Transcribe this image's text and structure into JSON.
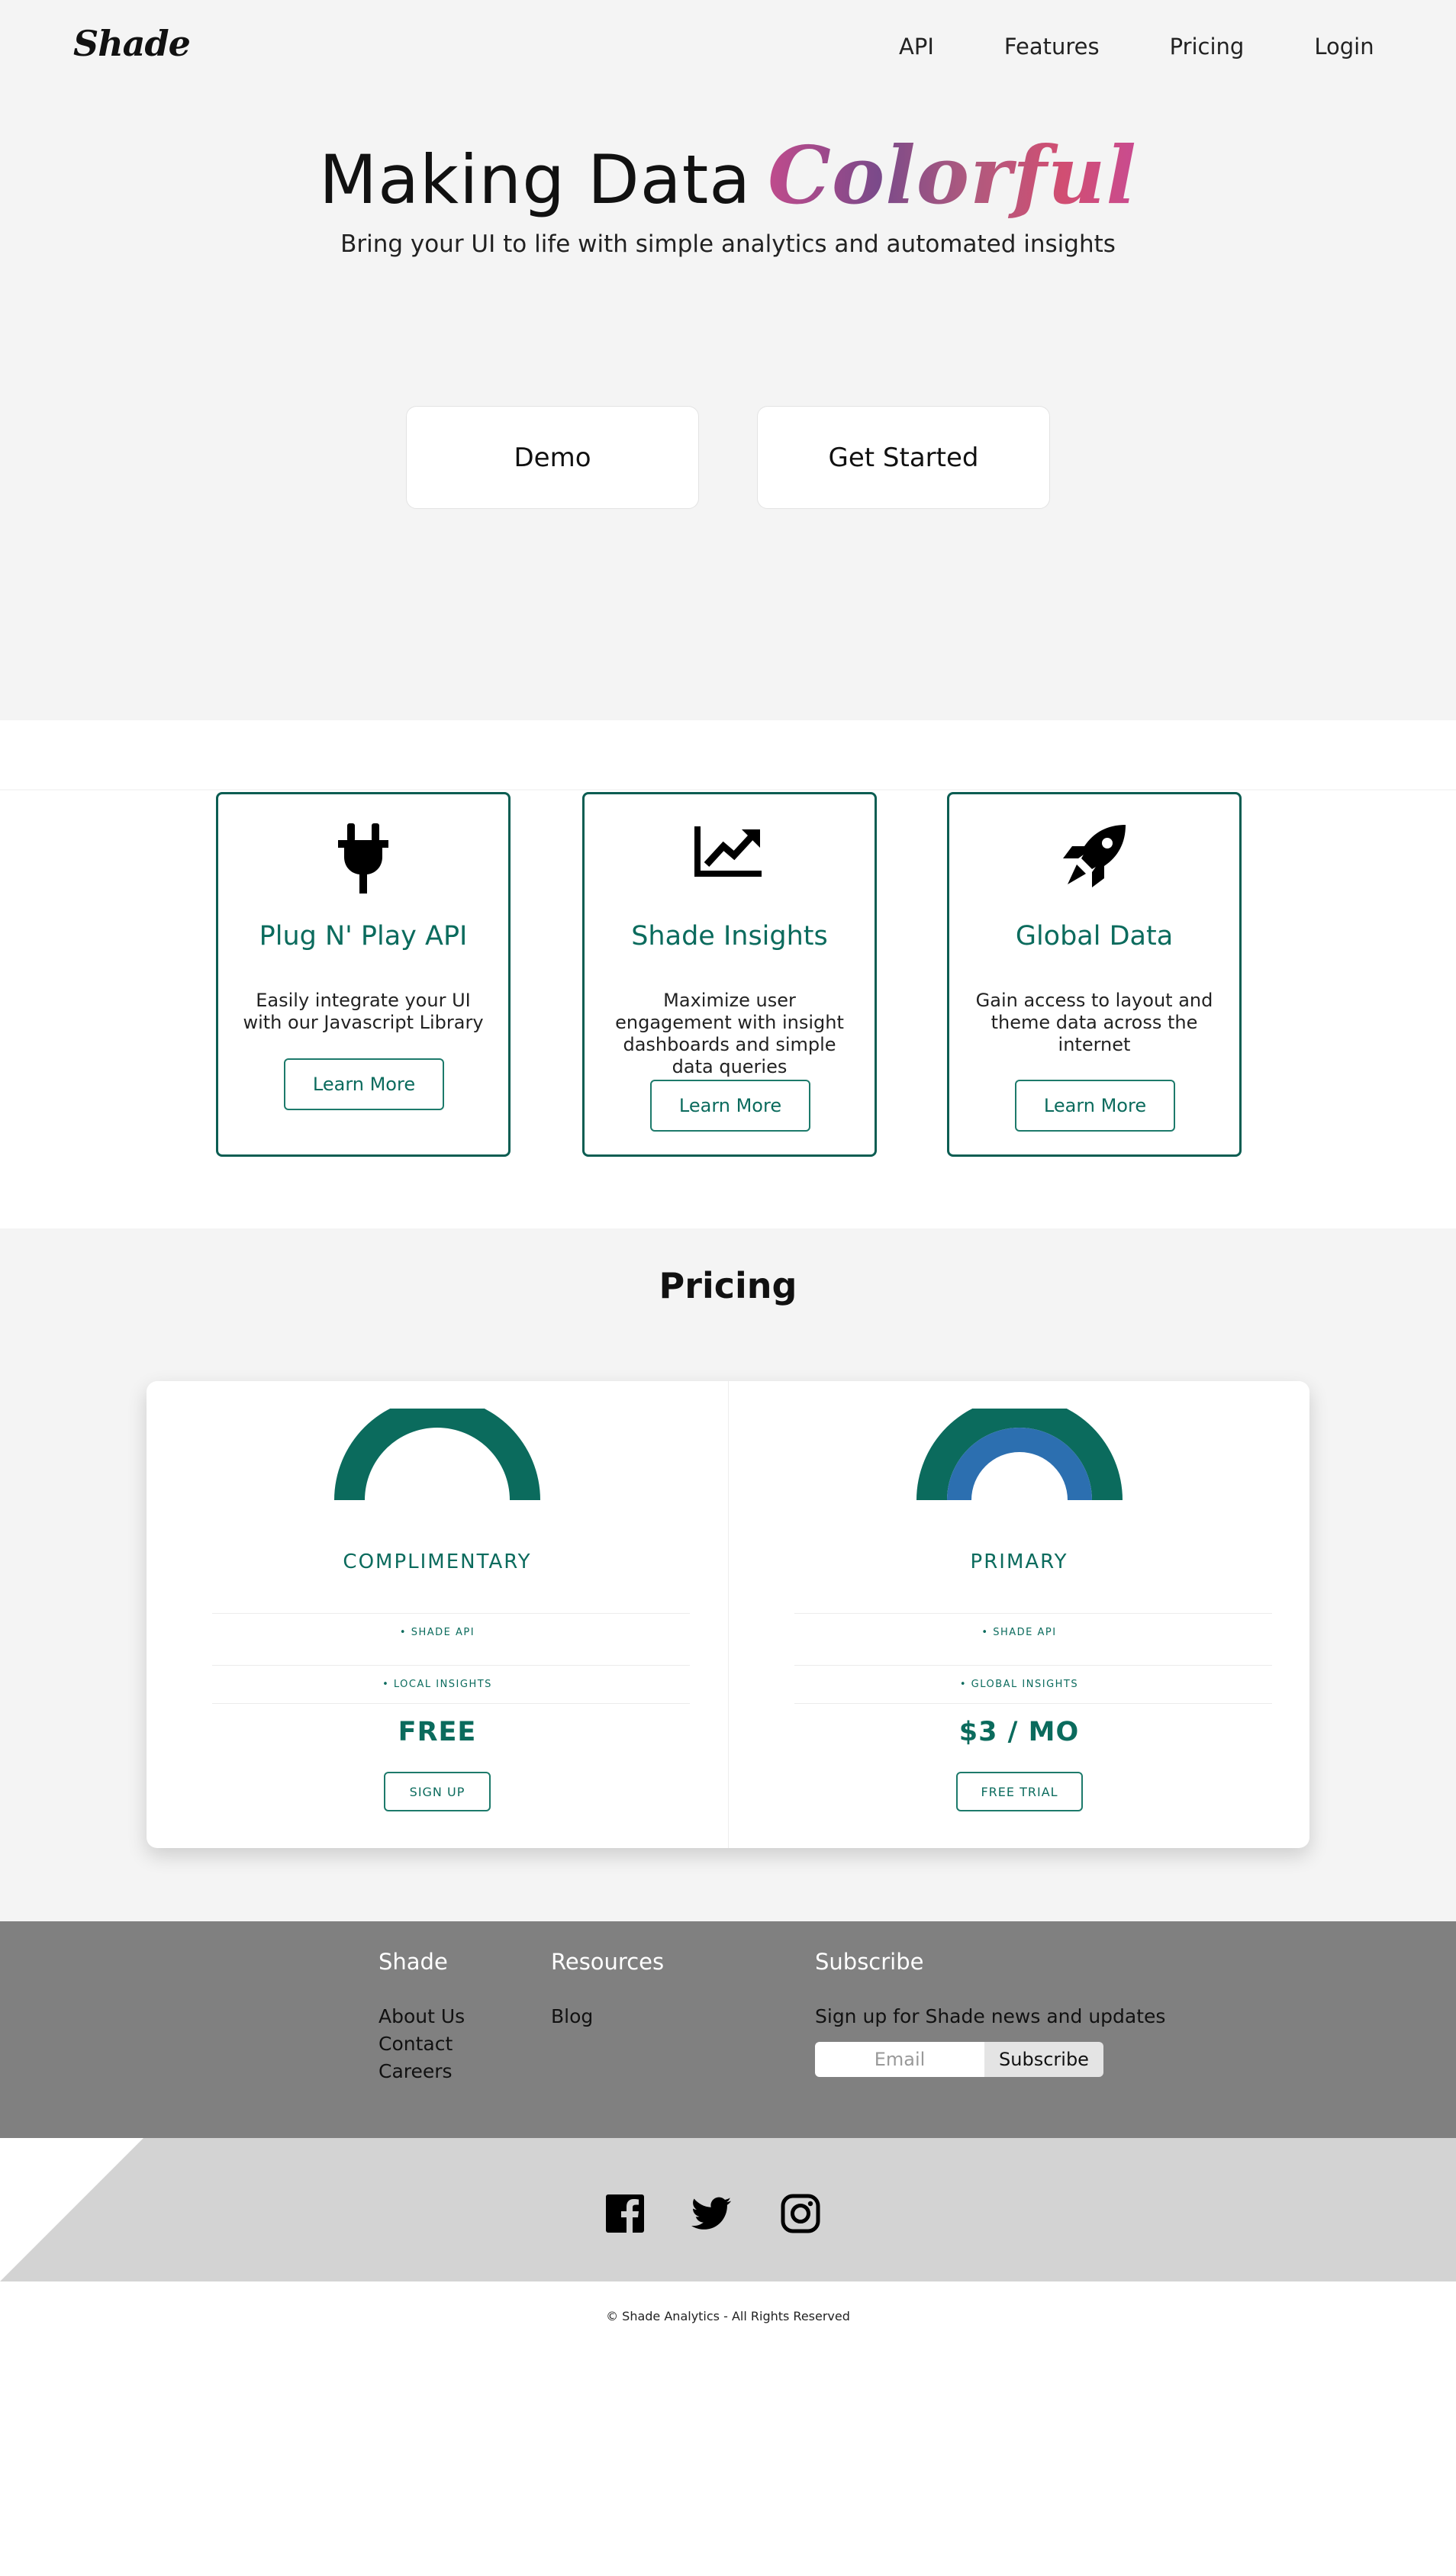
{
  "header": {
    "logo": "Shade",
    "nav": [
      "API",
      "Features",
      "Pricing",
      "Login"
    ]
  },
  "hero": {
    "headline": "Making Data",
    "headline_accent": "Colorful",
    "subheadline": "Bring your UI to life with simple analytics and automated insights",
    "buttons": [
      "Demo",
      "Get Started"
    ]
  },
  "features": [
    {
      "icon": "plug-icon",
      "title": "Plug N' Play API",
      "description": "Easily integrate your UI with our Javascript Library",
      "button": "Learn More"
    },
    {
      "icon": "chart-line-icon",
      "title": "Shade Insights",
      "description": "Maximize user engagement with insight dashboards and simple data queries",
      "button": "Learn More"
    },
    {
      "icon": "rocket-icon",
      "title": "Global Data",
      "description": "Gain access to layout and theme data across the internet",
      "button": "Learn More"
    }
  ],
  "pricing": {
    "title": "Pricing",
    "plans": [
      {
        "name": "COMPLIMENTARY",
        "features": [
          "• SHADE API",
          "• LOCAL INSIGHTS"
        ],
        "price": "FREE",
        "button": "SIGN UP"
      },
      {
        "name": "PRIMARY",
        "features": [
          "• SHADE API",
          "• GLOBAL INSIGHTS"
        ],
        "price": "$3 / MO",
        "button": "FREE TRIAL"
      }
    ]
  },
  "footer": {
    "columns": [
      {
        "heading": "Shade",
        "links": [
          "About Us",
          "Contact",
          "Careers"
        ]
      },
      {
        "heading": "Resources",
        "links": [
          "Blog"
        ]
      }
    ],
    "subscribe": {
      "heading": "Subscribe",
      "text": "Sign up for Shade news and updates",
      "placeholder": "Email",
      "button": "Subscribe"
    },
    "social": [
      "facebook-icon",
      "twitter-icon",
      "instagram-icon"
    ],
    "copyright": "© Shade Analytics - All Rights Reserved"
  },
  "colors": {
    "accent": "#0b6b5d",
    "accent_blue": "#2c6fb0",
    "hero_bg": "#f4f4f4",
    "footer_bg": "#808080",
    "social_bg": "#d3d3d3"
  }
}
